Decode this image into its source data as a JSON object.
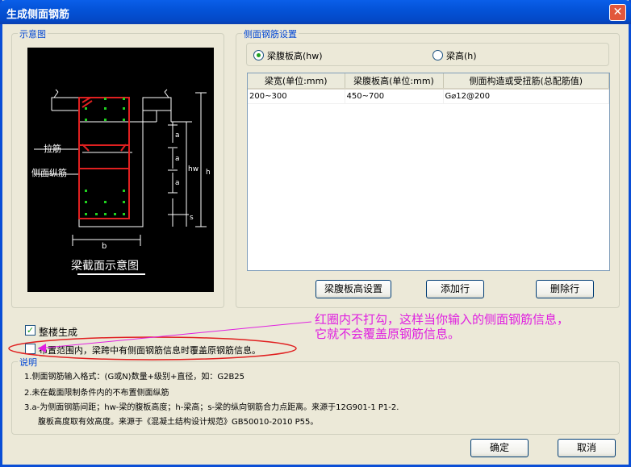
{
  "window": {
    "title": "生成侧面钢筋",
    "close_icon": "close-icon"
  },
  "diagram": {
    "group_label": "示意图",
    "label_tie": "拉筋",
    "label_side": "侧面纵筋",
    "dim_a1": "a",
    "dim_a2": "a",
    "dim_a3": "a",
    "dim_s": "s",
    "dim_hw": "hw",
    "dim_h": "h",
    "dim_b": "b",
    "caption": "梁截面示意图"
  },
  "settings": {
    "group_label": "侧面钢筋设置",
    "radio_web": "梁腹板高(hw)",
    "radio_h": "梁高(h)",
    "columns": [
      "梁宽(单位:mm)",
      "梁腹板高(单位:mm)",
      "侧面构造或受扭筋(总配筋值)"
    ],
    "rows": [
      [
        "200~300",
        "450~700",
        "G⌀12@200"
      ]
    ],
    "btn_web": "梁腹板高设置",
    "btn_add": "添加行",
    "btn_del": "删除行"
  },
  "options": {
    "whole": "整楼生成",
    "cover": "布置范围内，梁跨中有侧面钢筋信息时覆盖原钢筋信息。"
  },
  "annotation": {
    "line1": "红圈内不打勾，这样当你输入的侧面钢筋信息，",
    "line2": "它就不会覆盖原钢筋信息。"
  },
  "explain": {
    "label": "说明",
    "n1": "1.侧面钢筋输入格式：(G或N)数量+级别+直径，如：G2B25",
    "n2": "2.未在截面限制条件内的不布置侧面纵筋",
    "n3": "3.a-为侧面钢筋间距；hw-梁的腹板高度；h-梁高；s-梁的纵向钢筋合力点距离。来源于12G901-1 P1-2.",
    "n4": "腹板高度取有效高度。来源于《混凝土结构设计规范》GB50010-2010 P55。"
  },
  "footer": {
    "ok": "确定",
    "cancel": "取消"
  },
  "colors": {
    "accent_red": "#e02020",
    "annotation": "#e020e0",
    "group_label": "#0046d5"
  }
}
